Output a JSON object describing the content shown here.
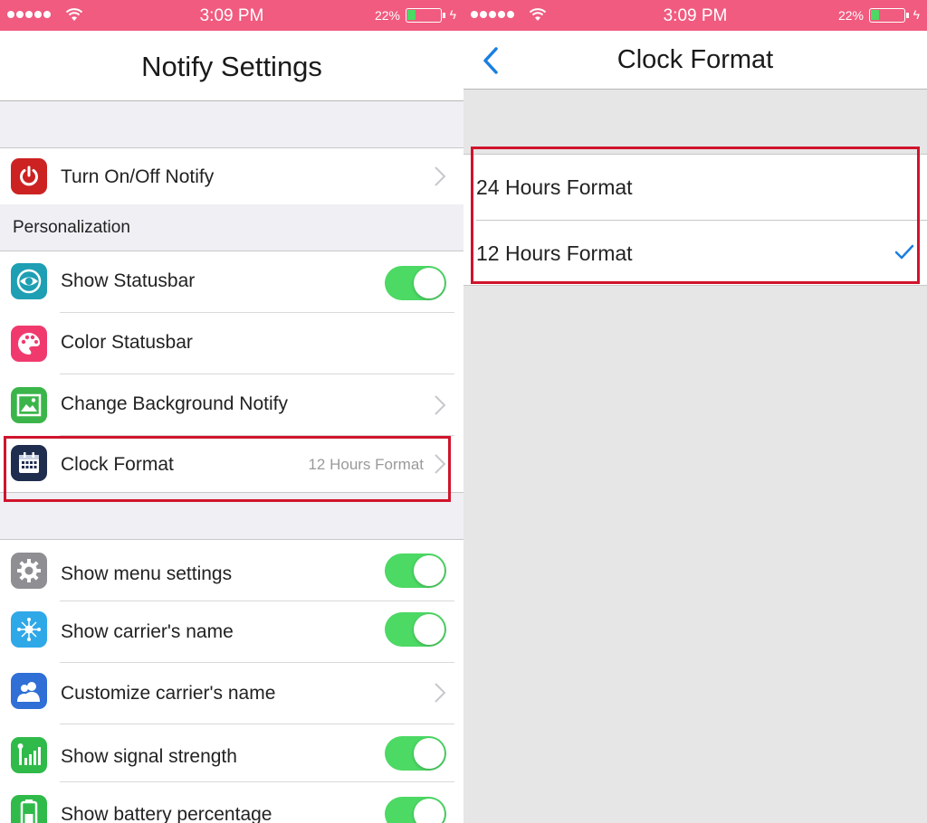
{
  "status_bar": {
    "time": "3:09 PM",
    "battery_percent": "22%",
    "battery_level": 0.22
  },
  "colors": {
    "status_bar": "#f05b7f",
    "toggle_on": "#4cd964",
    "accent": "#1a7fe0",
    "highlight": "#d0142c"
  },
  "left": {
    "title": "Notify Settings",
    "row_turn_on_off": {
      "label": "Turn On/Off Notify",
      "icon": "power-icon"
    },
    "section_title": "Personalization",
    "personalization": [
      {
        "label": "Show Statusbar",
        "icon": "eye-icon",
        "control": "toggle",
        "on": true
      },
      {
        "label": "Color Statusbar",
        "icon": "palette-icon",
        "control": "none"
      },
      {
        "label": "Change Background Notify",
        "icon": "image-icon",
        "control": "chevron"
      },
      {
        "label": "Clock Format",
        "icon": "calendar-icon",
        "control": "chevron",
        "value": "12 Hours Format"
      }
    ],
    "more": [
      {
        "label": "Show menu settings",
        "icon": "gear-icon",
        "control": "toggle",
        "on": true
      },
      {
        "label": "Show carrier's name",
        "icon": "network-icon",
        "control": "toggle",
        "on": true
      },
      {
        "label": "Customize carrier's name",
        "icon": "users-icon",
        "control": "chevron"
      },
      {
        "label": "Show signal strength",
        "icon": "signal-icon",
        "control": "toggle",
        "on": true
      },
      {
        "label": "Show battery percentage",
        "icon": "battery-icon",
        "control": "toggle",
        "on": true
      }
    ]
  },
  "right": {
    "title": "Clock Format",
    "options": [
      {
        "label": "24 Hours Format",
        "selected": false
      },
      {
        "label": "12 Hours Format",
        "selected": true
      }
    ]
  }
}
